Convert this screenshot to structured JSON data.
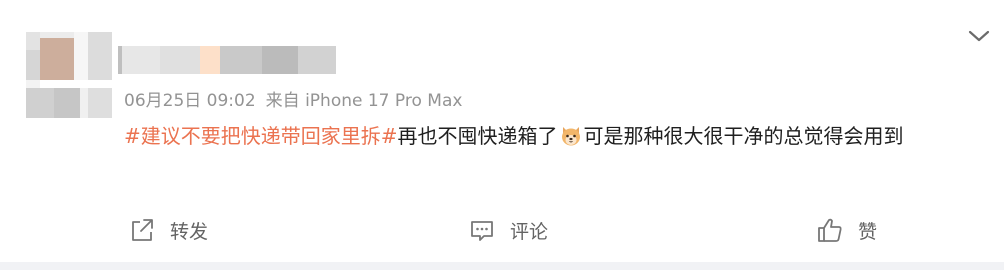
{
  "post": {
    "author": {
      "avatar_icon": "pixelated-avatar",
      "name_icon": "pixelated-username"
    },
    "meta": {
      "timestamp": "06月25日 09:02",
      "source": "来自 iPhone 17 Pro Max"
    },
    "content": {
      "topic": "#建议不要把快递带回家里拆#",
      "text_before_emoji": "再也不囤快递箱了",
      "emoji_icon": "dog-face-emoji",
      "text_after_emoji": "可是那种很大很干净的总觉得会用到"
    },
    "actions": {
      "repost_label": "转发",
      "comment_label": "评论",
      "like_label": "赞"
    }
  },
  "colors": {
    "topic": "#eb7350",
    "meta": "#939393",
    "text": "#1f1f1f",
    "action": "#636363",
    "page_bg": "#f1f2f5"
  }
}
